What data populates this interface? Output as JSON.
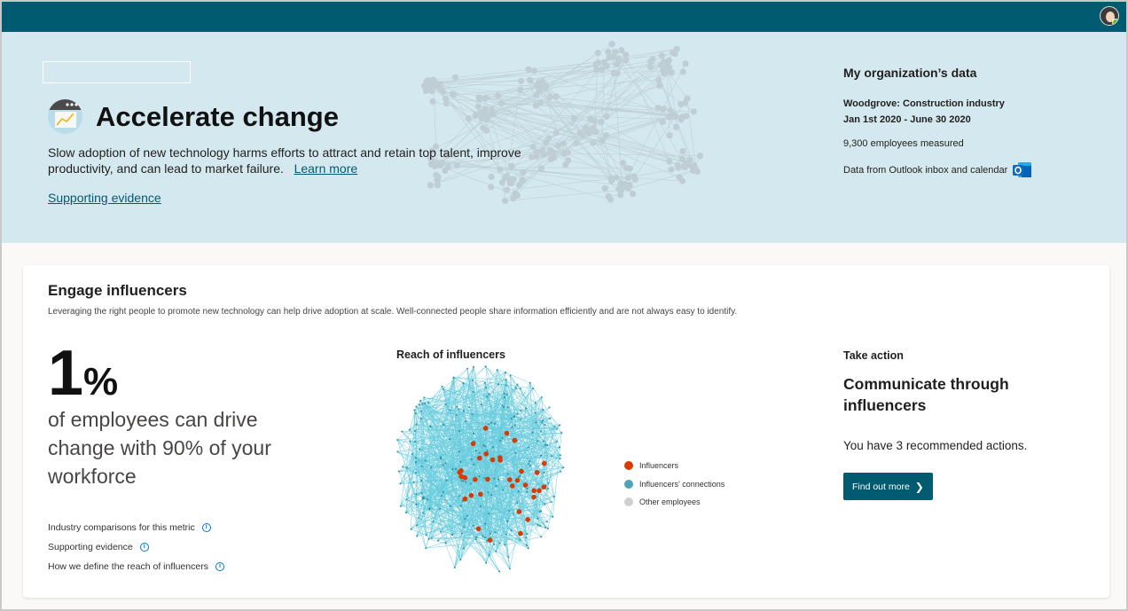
{
  "hero": {
    "title": "Accelerate change",
    "description": "Slow adoption of new technology harms efforts to attract and retain top talent, improve productivity, and can lead to market failure.",
    "learn_more": "Learn more",
    "supporting_evidence": "Supporting evidence"
  },
  "org": {
    "title": "My organization’s data",
    "company": "Woodgrove:  Construction industry",
    "dates": "Jan 1st 2020 - June 30 2020",
    "employees": "9,300 employees measured",
    "source": "Data from Outlook inbox and calendar",
    "source_icon": "outlook-icon"
  },
  "card": {
    "title": "Engage influencers",
    "description": "Leveraging the right people to promote new technology can help drive adoption at scale. Well-connected people share information efficiently and are not always easy to identify.",
    "metric_value": "1",
    "metric_unit": "%",
    "metric_text": "of employees can drive change with 90% of your workforce",
    "links": [
      "Industry comparisons for this metric",
      "Supporting evidence",
      "How we define the reach of influencers"
    ],
    "chart_title": "Reach of influencers",
    "legend": [
      {
        "label": "Influencers",
        "color": "#d83b01"
      },
      {
        "label": "Influencers’ connections",
        "color": "#4ea4b5"
      },
      {
        "label": "Other employees",
        "color": "#d0d0d0"
      }
    ],
    "action_label": "Take action",
    "action_head": "Communicate through influencers",
    "action_text": "You have 3 recommended actions.",
    "action_button": "Find out more"
  },
  "colors": {
    "topbar": "#005b70",
    "hero_bg": "#d4e8ef",
    "button": "#005b70",
    "network": "#4ec3d8",
    "influencer": "#d83b01"
  }
}
